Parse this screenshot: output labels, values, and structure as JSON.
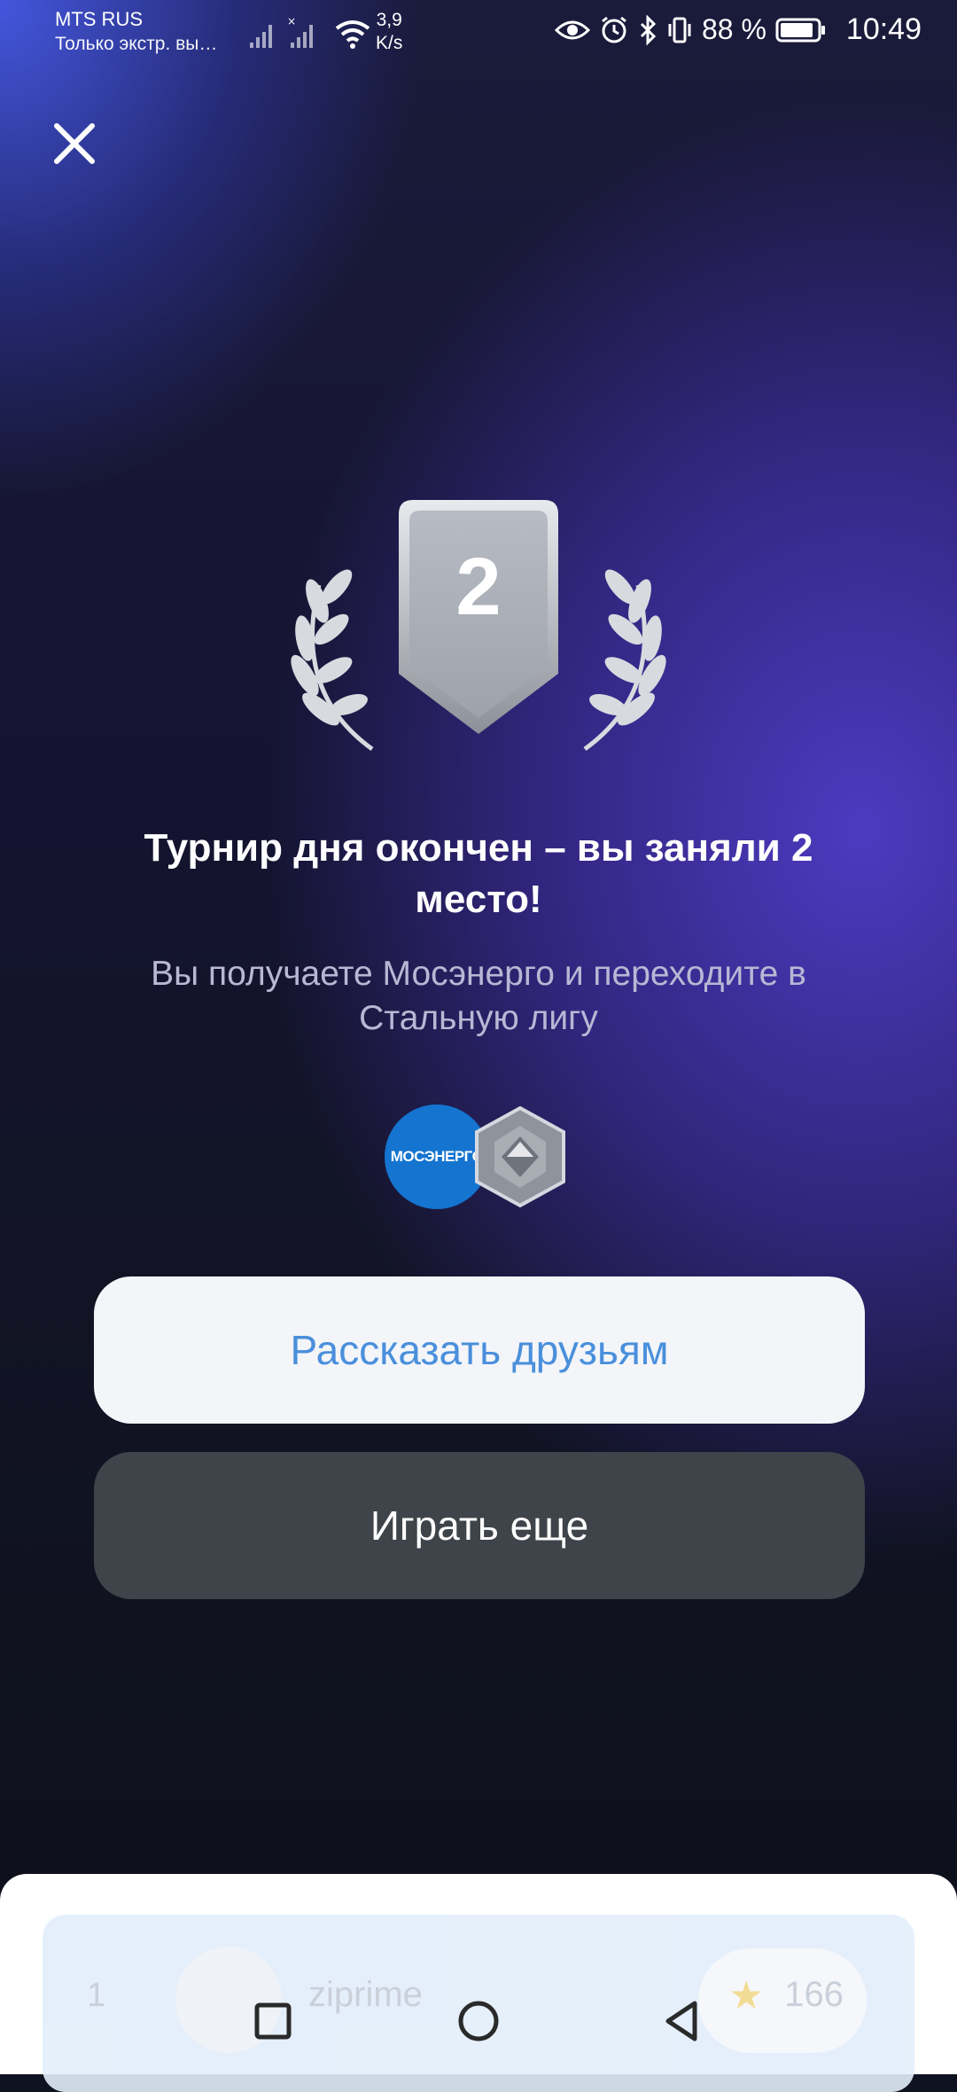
{
  "status_bar": {
    "carrier": "MTS RUS",
    "carrier_sub": "Только экстр. вы…",
    "net_speed_value": "3,9",
    "net_speed_unit": "K/s",
    "battery_pct": "88 %",
    "time": "10:49",
    "icons": [
      "signal-icon",
      "signal-x-icon",
      "wifi-icon",
      "eye-icon",
      "alarm-icon",
      "bluetooth-icon",
      "vibrate-icon",
      "battery-icon"
    ]
  },
  "result": {
    "place_number": "2",
    "headline": "Турнир дня окончен – вы заняли 2 место!",
    "subline": "Вы получаете Мосэнерго и переходите в Стальную лигу",
    "reward_logo_text": "МОСЭНЕРГО"
  },
  "buttons": {
    "share_label": "Рассказать друзьям",
    "play_label": "Играть еще"
  },
  "leaderboard_peek": {
    "rank": "1",
    "name": "ziprime",
    "score": "166"
  },
  "colors": {
    "accent_blue": "#4a8fdc",
    "brand_blue": "#1474d0",
    "play_button": "#3e4449"
  }
}
